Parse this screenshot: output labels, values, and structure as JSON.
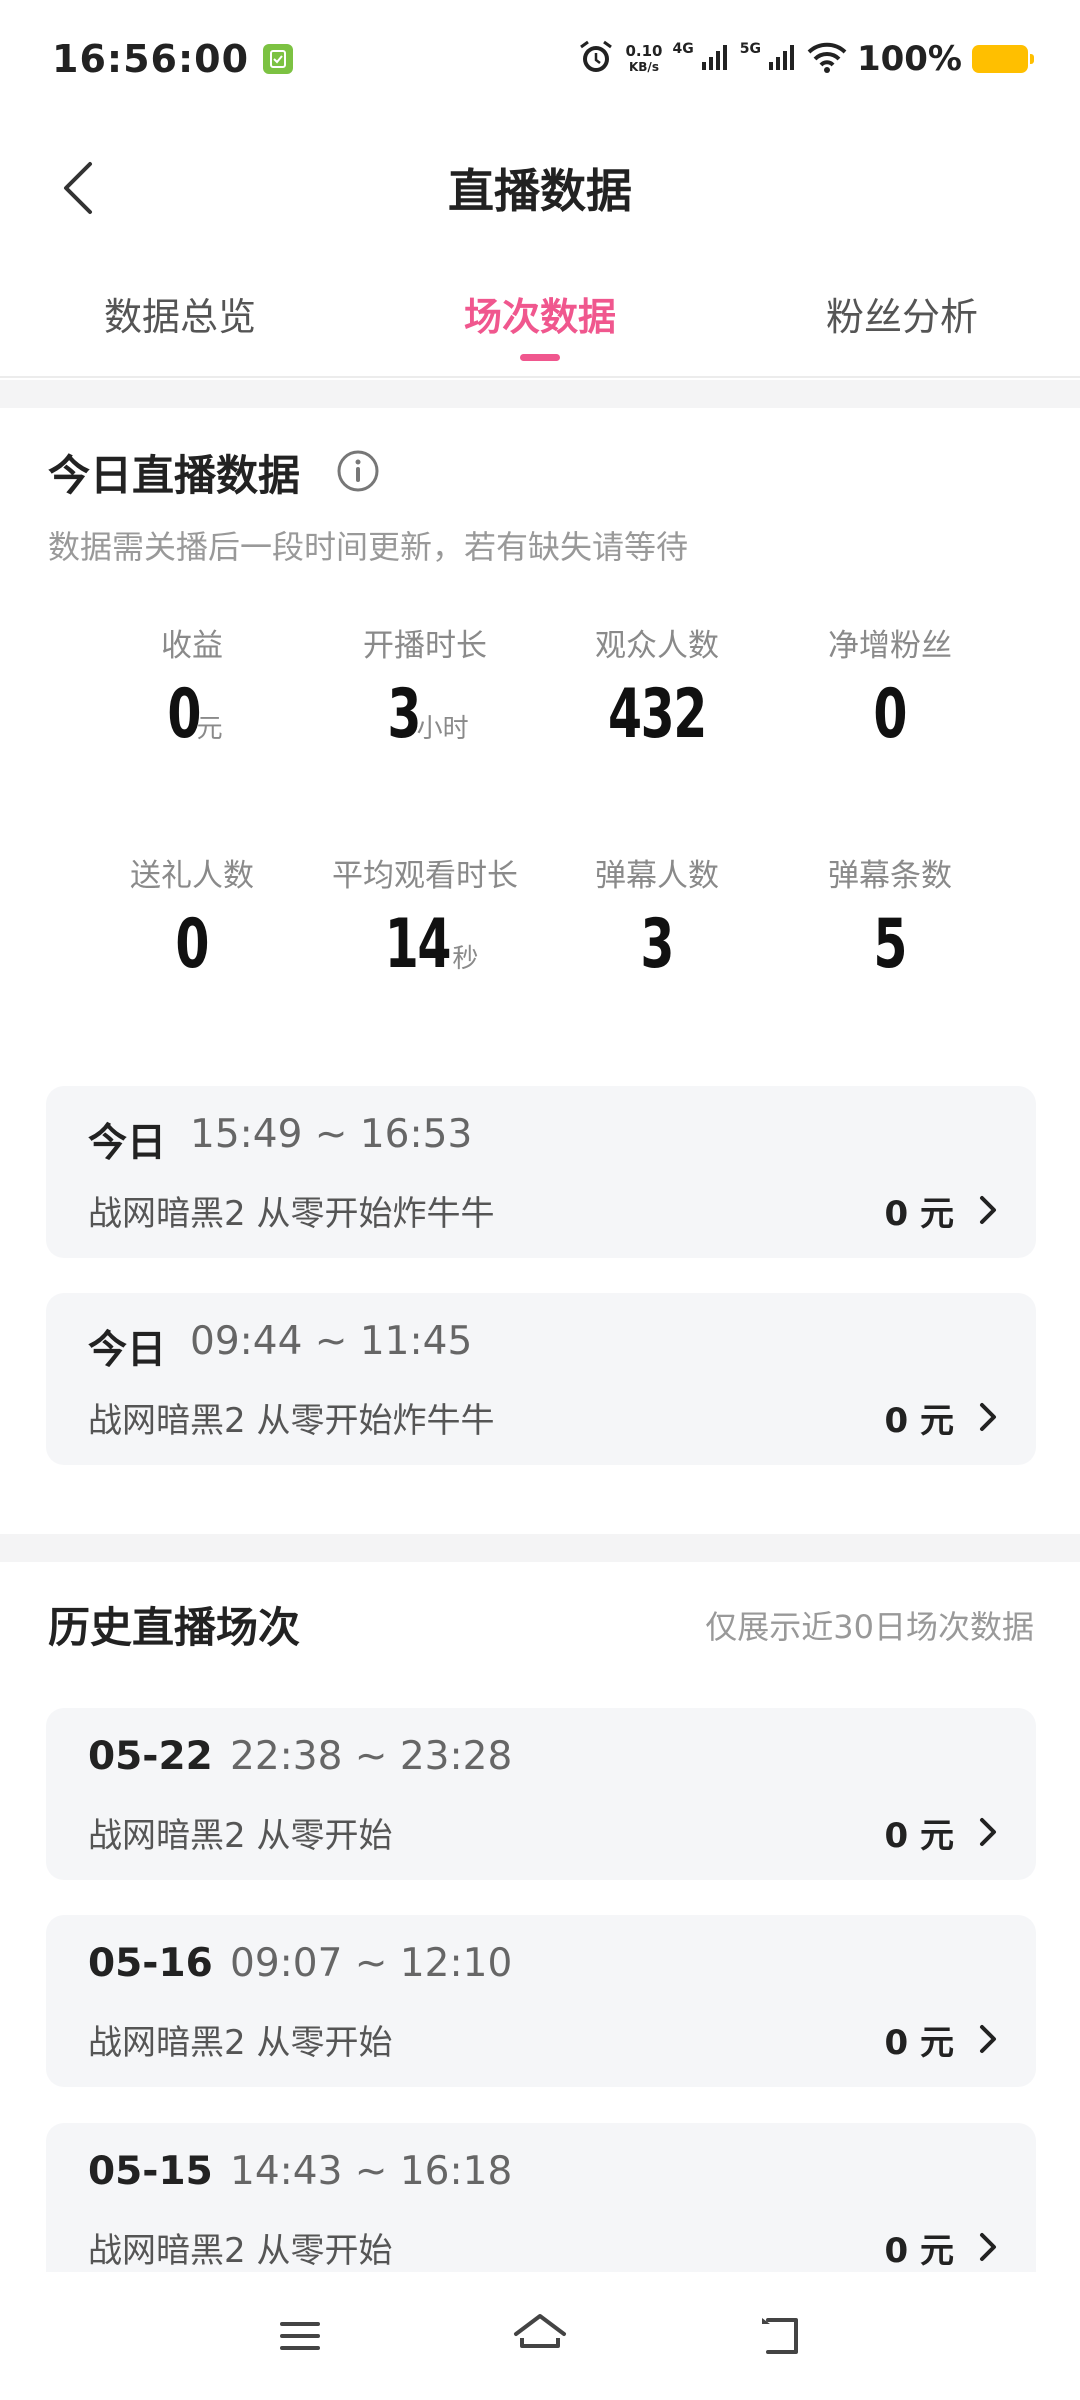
{
  "status_bar": {
    "time": "16:56:00",
    "speed_value": "0.10",
    "speed_unit": "KB/s",
    "net_4g": "4G",
    "net_5g": "5G",
    "battery": "100%",
    "battery_color": "#ffbf00"
  },
  "header": {
    "title": "直播数据"
  },
  "tabs": [
    {
      "label": "数据总览",
      "active": false
    },
    {
      "label": "场次数据",
      "active": true
    },
    {
      "label": "粉丝分析",
      "active": false
    }
  ],
  "accent_color": "#f0578e",
  "today": {
    "title": "今日直播数据",
    "subtitle": "数据需关播后一段时间更新，若有缺失请等待",
    "metrics": [
      {
        "label": "收益",
        "value": "0",
        "unit": "元"
      },
      {
        "label": "开播时长",
        "value": "3",
        "unit": "小时"
      },
      {
        "label": "观众人数",
        "value": "432",
        "unit": ""
      },
      {
        "label": "净增粉丝",
        "value": "0",
        "unit": ""
      },
      {
        "label": "送礼人数",
        "value": "0",
        "unit": ""
      },
      {
        "label": "平均观看时长",
        "value": "14",
        "unit": "秒"
      },
      {
        "label": "弹幕人数",
        "value": "3",
        "unit": ""
      },
      {
        "label": "弹幕条数",
        "value": "5",
        "unit": ""
      }
    ],
    "sessions": [
      {
        "date": "今日",
        "time": "15:49 ~ 16:53",
        "name": "战网暗黑2 从零开始炸牛牛",
        "amount": "0 元"
      },
      {
        "date": "今日",
        "time": "09:44 ~ 11:45",
        "name": "战网暗黑2 从零开始炸牛牛",
        "amount": "0 元"
      }
    ]
  },
  "history": {
    "title": "历史直播场次",
    "note": "仅展示近30日场次数据",
    "sessions": [
      {
        "date": "05-22",
        "time": "22:38 ~ 23:28",
        "name": "战网暗黑2 从零开始",
        "amount": "0 元"
      },
      {
        "date": "05-16",
        "time": "09:07 ~ 12:10",
        "name": "战网暗黑2 从零开始",
        "amount": "0 元"
      },
      {
        "date": "05-15",
        "time": "14:43 ~ 16:18",
        "name": "战网暗黑2 从零开始",
        "amount": "0 元"
      }
    ]
  },
  "icons": {
    "back": "chevron-left-icon",
    "info": "info-icon",
    "row": "chevron-right-icon",
    "nav_menu": "menu-icon",
    "nav_home": "home-icon",
    "nav_back": "return-icon"
  }
}
